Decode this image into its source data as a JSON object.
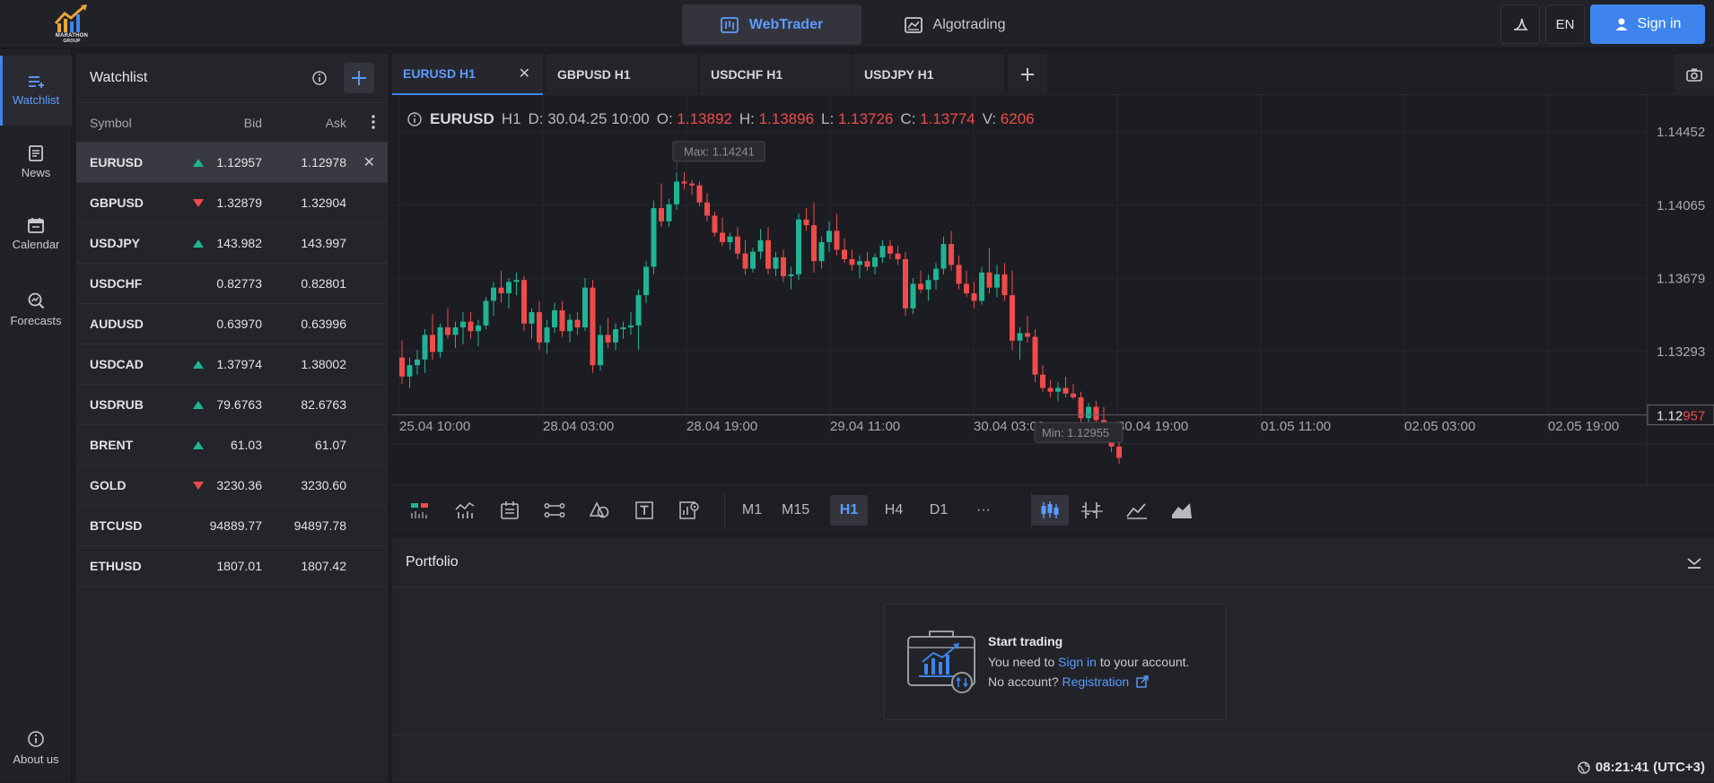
{
  "brand": {
    "logo_text": "MARATHON",
    "logo_sub": "GROUP"
  },
  "mode_tabs": [
    {
      "label": "WebTrader",
      "active": true
    },
    {
      "label": "Algotrading",
      "active": false
    }
  ],
  "header": {
    "lang": "EN",
    "signin_label": "Sign in"
  },
  "leftnav": {
    "items": [
      {
        "label": "Watchlist",
        "icon": "watchlist-icon",
        "active": true
      },
      {
        "label": "News",
        "icon": "news-icon",
        "active": false
      },
      {
        "label": "Calendar",
        "icon": "calendar-icon",
        "active": false
      },
      {
        "label": "Forecasts",
        "icon": "forecasts-icon",
        "active": false
      }
    ],
    "about_label": "About us"
  },
  "watchlist": {
    "title": "Watchlist",
    "columns": {
      "symbol": "Symbol",
      "bid": "Bid",
      "ask": "Ask"
    },
    "rows": [
      {
        "symbol": "EURUSD",
        "trend": "up",
        "bid": "1.12957",
        "ask": "1.12978",
        "selected": true
      },
      {
        "symbol": "GBPUSD",
        "trend": "down",
        "bid": "1.32879",
        "ask": "1.32904"
      },
      {
        "symbol": "USDJPY",
        "trend": "up",
        "bid": "143.982",
        "ask": "143.997"
      },
      {
        "symbol": "USDCHF",
        "trend": "none",
        "bid": "0.82773",
        "ask": "0.82801"
      },
      {
        "symbol": "AUDUSD",
        "trend": "none",
        "bid": "0.63970",
        "ask": "0.63996"
      },
      {
        "symbol": "USDCAD",
        "trend": "up",
        "bid": "1.37974",
        "ask": "1.38002"
      },
      {
        "symbol": "USDRUB",
        "trend": "up",
        "bid": "79.6763",
        "ask": "82.6763"
      },
      {
        "symbol": "BRENT",
        "trend": "up",
        "bid": "61.03",
        "ask": "61.07"
      },
      {
        "symbol": "GOLD",
        "trend": "down",
        "bid": "3230.36",
        "ask": "3230.60"
      },
      {
        "symbol": "BTCUSD",
        "trend": "none",
        "bid": "94889.77",
        "ask": "94897.78"
      },
      {
        "symbol": "ETHUSD",
        "trend": "none",
        "bid": "1807.01",
        "ask": "1807.42"
      }
    ]
  },
  "chart_tabs": [
    {
      "label": "EURUSD H1",
      "active": true
    },
    {
      "label": "GBPUSD H1",
      "active": false
    },
    {
      "label": "USDCHF H1",
      "active": false
    },
    {
      "label": "USDJPY H1",
      "active": false
    }
  ],
  "ohlc": {
    "symbol": "EURUSD",
    "tf": "H1",
    "date_label": "D:",
    "date": "30.04.25 10:00",
    "o_label": "O:",
    "o": "1.13892",
    "h_label": "H:",
    "h": "1.13896",
    "l_label": "L:",
    "l": "1.13726",
    "c_label": "C:",
    "c": "1.13774",
    "v_label": "V:",
    "v": "6206"
  },
  "timeframes": [
    {
      "label": "M1",
      "active": false
    },
    {
      "label": "M15",
      "active": false
    },
    {
      "label": "H1",
      "active": true
    },
    {
      "label": "H4",
      "active": false
    },
    {
      "label": "D1",
      "active": false
    },
    {
      "label": "···",
      "active": false
    }
  ],
  "chart_data": {
    "type": "candlestick",
    "symbol": "EURUSD",
    "timeframe": "H1",
    "x_ticks": [
      "25.04 10:00",
      "28.04 03:00",
      "28.04 19:00",
      "29.04 11:00",
      "30.04 03:00",
      "30.04 19:00",
      "01.05 11:00",
      "02.05 03:00",
      "02.05 19:00"
    ],
    "y_ticks": [
      1.14452,
      1.14065,
      1.13679,
      1.13293
    ],
    "ylim": [
      1.1287,
      1.146
    ],
    "max_label": "Max: 1.14241",
    "min_label": "Min: 1.12955",
    "current_price_prefix": "1.12",
    "current_price_suffix": "957",
    "current_price": 1.12957,
    "max": 1.14241,
    "min": 1.12955,
    "grid": true,
    "colors": {
      "up": "#20b394",
      "down": "#ef4b4b"
    },
    "candles": [
      [
        1.1326,
        1.1335,
        1.1312,
        1.1316
      ],
      [
        1.1316,
        1.1326,
        1.131,
        1.1322
      ],
      [
        1.1322,
        1.133,
        1.1317,
        1.1325
      ],
      [
        1.1325,
        1.1341,
        1.1318,
        1.1338
      ],
      [
        1.1338,
        1.1349,
        1.1325,
        1.1329
      ],
      [
        1.1329,
        1.1344,
        1.1326,
        1.1342
      ],
      [
        1.1342,
        1.1352,
        1.1336,
        1.1338
      ],
      [
        1.1338,
        1.1345,
        1.1331,
        1.1342
      ],
      [
        1.1342,
        1.135,
        1.1333,
        1.1345
      ],
      [
        1.1345,
        1.135,
        1.1336,
        1.134
      ],
      [
        1.134,
        1.1346,
        1.1332,
        1.1343
      ],
      [
        1.1343,
        1.1358,
        1.1341,
        1.1356
      ],
      [
        1.1356,
        1.1366,
        1.1348,
        1.1363
      ],
      [
        1.1363,
        1.1372,
        1.1355,
        1.136
      ],
      [
        1.136,
        1.1368,
        1.1352,
        1.1366
      ],
      [
        1.1366,
        1.1371,
        1.1359,
        1.1367
      ],
      [
        1.1367,
        1.1369,
        1.134,
        1.1344
      ],
      [
        1.1344,
        1.1352,
        1.1336,
        1.135
      ],
      [
        1.135,
        1.1356,
        1.133,
        1.1334
      ],
      [
        1.1334,
        1.1346,
        1.1328,
        1.1342
      ],
      [
        1.1342,
        1.1355,
        1.1339,
        1.1351
      ],
      [
        1.1351,
        1.1356,
        1.1337,
        1.134
      ],
      [
        1.134,
        1.1349,
        1.1334,
        1.1346
      ],
      [
        1.1346,
        1.135,
        1.1338,
        1.1342
      ],
      [
        1.1342,
        1.1368,
        1.134,
        1.1363
      ],
      [
        1.1363,
        1.1367,
        1.1318,
        1.1322
      ],
      [
        1.1322,
        1.1343,
        1.1319,
        1.1338
      ],
      [
        1.1338,
        1.1347,
        1.1331,
        1.1334
      ],
      [
        1.1334,
        1.1344,
        1.133,
        1.1341
      ],
      [
        1.1341,
        1.1345,
        1.1336,
        1.1342
      ],
      [
        1.1342,
        1.135,
        1.1338,
        1.1343
      ],
      [
        1.1343,
        1.1362,
        1.133,
        1.1359
      ],
      [
        1.1359,
        1.1377,
        1.1355,
        1.1374
      ],
      [
        1.1374,
        1.1409,
        1.137,
        1.1405
      ],
      [
        1.1405,
        1.1418,
        1.1395,
        1.1398
      ],
      [
        1.1398,
        1.141,
        1.1395,
        1.1407
      ],
      [
        1.1407,
        1.1424,
        1.1404,
        1.1419
      ],
      [
        1.1419,
        1.1424,
        1.1415,
        1.1418
      ],
      [
        1.1418,
        1.142,
        1.1412,
        1.1417
      ],
      [
        1.1417,
        1.1419,
        1.1406,
        1.1408
      ],
      [
        1.1408,
        1.1413,
        1.1398,
        1.1401
      ],
      [
        1.1401,
        1.1403,
        1.139,
        1.1392
      ],
      [
        1.1392,
        1.14,
        1.1385,
        1.1387
      ],
      [
        1.1387,
        1.1392,
        1.1383,
        1.139
      ],
      [
        1.139,
        1.1395,
        1.1378,
        1.1381
      ],
      [
        1.1381,
        1.1388,
        1.137,
        1.1373
      ],
      [
        1.1373,
        1.1384,
        1.1371,
        1.1382
      ],
      [
        1.1382,
        1.1394,
        1.1378,
        1.1388
      ],
      [
        1.1388,
        1.1395,
        1.137,
        1.1373
      ],
      [
        1.1373,
        1.1382,
        1.1369,
        1.1379
      ],
      [
        1.1379,
        1.1383,
        1.1366,
        1.1369
      ],
      [
        1.1369,
        1.1374,
        1.1362,
        1.137
      ],
      [
        1.137,
        1.1402,
        1.1367,
        1.1399
      ],
      [
        1.1399,
        1.1405,
        1.1393,
        1.1396
      ],
      [
        1.1396,
        1.1408,
        1.1371,
        1.1377
      ],
      [
        1.1377,
        1.139,
        1.1373,
        1.1387
      ],
      [
        1.1387,
        1.1398,
        1.1382,
        1.1393
      ],
      [
        1.1393,
        1.1402,
        1.138,
        1.1383
      ],
      [
        1.1383,
        1.1389,
        1.1376,
        1.1378
      ],
      [
        1.1378,
        1.1383,
        1.1372,
        1.1375
      ],
      [
        1.1375,
        1.138,
        1.1368,
        1.1377
      ],
      [
        1.1377,
        1.1382,
        1.1372,
        1.1374
      ],
      [
        1.1374,
        1.1381,
        1.137,
        1.1379
      ],
      [
        1.1379,
        1.1388,
        1.1376,
        1.1385
      ],
      [
        1.1385,
        1.1388,
        1.1378,
        1.1381
      ],
      [
        1.1381,
        1.1385,
        1.1375,
        1.1378
      ],
      [
        1.1378,
        1.1382,
        1.1348,
        1.1352
      ],
      [
        1.1352,
        1.1368,
        1.1349,
        1.1365
      ],
      [
        1.1365,
        1.1372,
        1.136,
        1.1362
      ],
      [
        1.1362,
        1.137,
        1.1356,
        1.1367
      ],
      [
        1.1367,
        1.1376,
        1.1362,
        1.1373
      ],
      [
        1.1373,
        1.139,
        1.137,
        1.1386
      ],
      [
        1.1386,
        1.1393,
        1.1372,
        1.1375
      ],
      [
        1.1375,
        1.138,
        1.1362,
        1.1365
      ],
      [
        1.1365,
        1.1372,
        1.1358,
        1.136
      ],
      [
        1.136,
        1.1366,
        1.1352,
        1.1356
      ],
      [
        1.1356,
        1.1374,
        1.1354,
        1.1371
      ],
      [
        1.1371,
        1.1384,
        1.136,
        1.1363
      ],
      [
        1.1363,
        1.1375,
        1.1358,
        1.137
      ],
      [
        1.137,
        1.1376,
        1.1356,
        1.1359
      ],
      [
        1.1359,
        1.1372,
        1.133,
        1.1335
      ],
      [
        1.1335,
        1.1342,
        1.1325,
        1.1339
      ],
      [
        1.1339,
        1.1348,
        1.1334,
        1.1337
      ],
      [
        1.1337,
        1.1341,
        1.1313,
        1.1317
      ],
      [
        1.1317,
        1.1322,
        1.1308,
        1.131
      ],
      [
        1.131,
        1.1314,
        1.1305,
        1.1308
      ],
      [
        1.1308,
        1.1313,
        1.1303,
        1.131
      ],
      [
        1.131,
        1.1316,
        1.1305,
        1.1307
      ],
      [
        1.1307,
        1.1312,
        1.1304,
        1.1305
      ],
      [
        1.1305,
        1.1308,
        1.129,
        1.1294
      ],
      [
        1.1294,
        1.1302,
        1.129,
        1.13
      ],
      [
        1.13,
        1.1303,
        1.1291,
        1.1293
      ],
      [
        1.1293,
        1.13,
        1.1285,
        1.1288
      ],
      [
        1.1288,
        1.1291,
        1.1276,
        1.1279
      ],
      [
        1.1279,
        1.1282,
        1.127,
        1.1273
      ]
    ]
  },
  "portfolio": {
    "title": "Portfolio",
    "empty_title": "Start trading",
    "line1_pre": "You need to ",
    "line1_link": "Sign in",
    "line1_post": " to your account.",
    "line2_pre": "No account? ",
    "line2_link": "Registration"
  },
  "clock": "08:21:41 (UTC+3)"
}
